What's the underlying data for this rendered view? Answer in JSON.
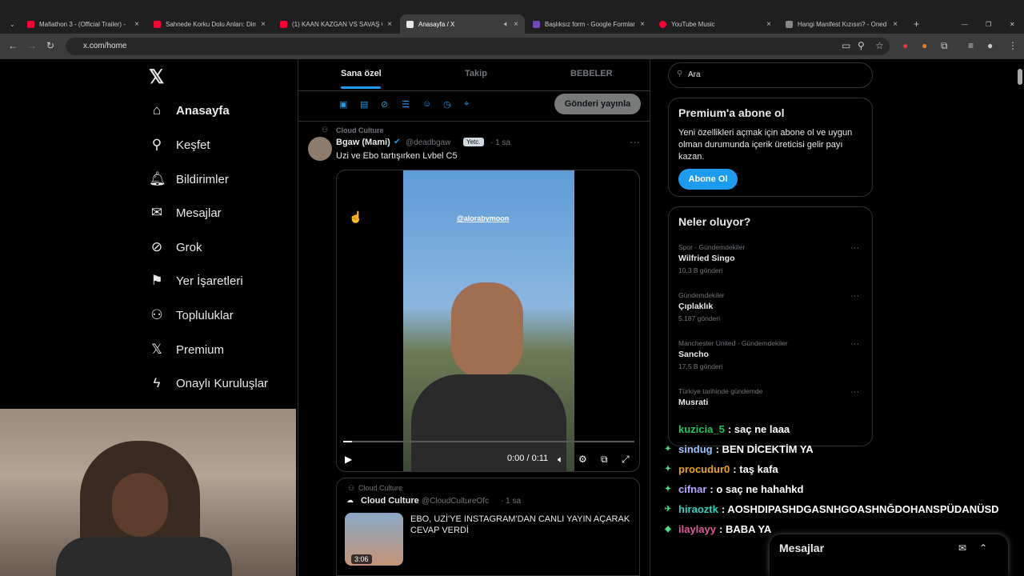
{
  "browser": {
    "tabs": [
      {
        "title": "Mafiathon 3 - (Official Trailer) -",
        "fav": "#ff0033"
      },
      {
        "title": "Sahnede Korku Dolu Anları: Dim",
        "fav": "#ff0033"
      },
      {
        "title": "(1) KAAN KAZGAN VS SAVAŞ C",
        "fav": "#ff0033"
      },
      {
        "title": "Anasayfa / X",
        "fav": "#e7e9ea"
      },
      {
        "title": "Başlıksız form - Google Formlar",
        "fav": "#7248b9"
      },
      {
        "title": "YouTube Music",
        "fav": "#ff0033"
      },
      {
        "title": "Hangi Manifest Kızısın? - Oned",
        "fav": "#888888"
      }
    ],
    "url": "x.com/home"
  },
  "sidebar": {
    "items": [
      {
        "label": "Anasayfa",
        "icon": "home-icon",
        "glyph": "⌂"
      },
      {
        "label": "Keşfet",
        "icon": "search-icon",
        "glyph": "⚲"
      },
      {
        "label": "Bildirimler",
        "icon": "bell-icon",
        "glyph": "🔔︎"
      },
      {
        "label": "Mesajlar",
        "icon": "mail-icon",
        "glyph": "✉"
      },
      {
        "label": "Grok",
        "icon": "grok-icon",
        "glyph": "⊘"
      },
      {
        "label": "Yer İşaretleri",
        "icon": "bookmark-icon",
        "glyph": "⚑"
      },
      {
        "label": "Topluluklar",
        "icon": "communities-icon",
        "glyph": "⚇"
      },
      {
        "label": "Premium",
        "icon": "x-icon",
        "glyph": "𝕏"
      },
      {
        "label": "Onaylı Kuruluşlar",
        "icon": "lightning-icon",
        "glyph": "ϟ"
      }
    ]
  },
  "timeline": {
    "tabs": [
      "Sana özel",
      "Takip",
      "BEBELER"
    ],
    "post_button": "Gönderi yayınla",
    "post1": {
      "community": "Cloud Culture",
      "author": "Bgaw (Mami)",
      "handle": "@deadbgaw",
      "badge": "Yetc.",
      "time": "· 1 sa",
      "text": "Uzi ve Ebo tartışırken Lvbel C5",
      "video_tag": "@alorabymoon",
      "video_time": "0:00 / 0:11",
      "progress": 0.03
    },
    "post2": {
      "community": "Cloud Culture",
      "author": "Cloud Culture",
      "handle": "@CloudCultureOfc",
      "time": "· 1 sa",
      "text": "EBO, UZİ'YE INSTAGRAM'DAN CANLI YAYIN AÇARAK CEVAP VERDİ",
      "duration": "3:06"
    }
  },
  "right": {
    "search_placeholder": "Ara",
    "premium": {
      "title": "Premium'a abone ol",
      "desc": "Yeni özellikleri açmak için abone ol ve uygun olman durumunda içerik üreticisi gelir payı kazan.",
      "button": "Abone Ol"
    },
    "trends_title": "Neler oluyor?",
    "trends": [
      {
        "ctx": "Spor · Gündemdekiler",
        "name": "Wilfried Singo",
        "count": "10,3 B gönderi"
      },
      {
        "ctx": "Gündemdekiler",
        "name": "Çıplaklık",
        "count": "5.187 gönderi"
      },
      {
        "ctx": "Manchester United · Gündemdekiler",
        "name": "Sancho",
        "count": "17,5 B gönderi"
      },
      {
        "ctx": "Türkiye tarihinde gündemde",
        "name": "Musrati",
        "count": ""
      }
    ]
  },
  "chat": [
    {
      "user": "kuzicia_5",
      "color": "#22c55e",
      "msg": ": saç ne laaa",
      "badge": ""
    },
    {
      "user": "sindug",
      "color": "#9ec4ff",
      "msg": ": BEN DİCEKTİM YA",
      "badge": "✦"
    },
    {
      "user": "procudur0",
      "color": "#e8a317",
      "msg": ": taş kafa",
      "badge": "✦"
    },
    {
      "user": "cifnar",
      "color": "#b8a6ff",
      "msg": ": o saç ne hahahkd",
      "badge": "✦"
    },
    {
      "user": "hiraoztk",
      "color": "#2dd4bf",
      "msg": ": AOSHDIPASHDGASNHGOASHNĞDOHANSPÜDANÜSD",
      "badge": "✈"
    },
    {
      "user": "ilaylayy",
      "color": "#e05a9a",
      "msg": ": BABA YA",
      "badge": "◆"
    }
  ],
  "messages_drawer": {
    "title": "Mesajlar"
  }
}
